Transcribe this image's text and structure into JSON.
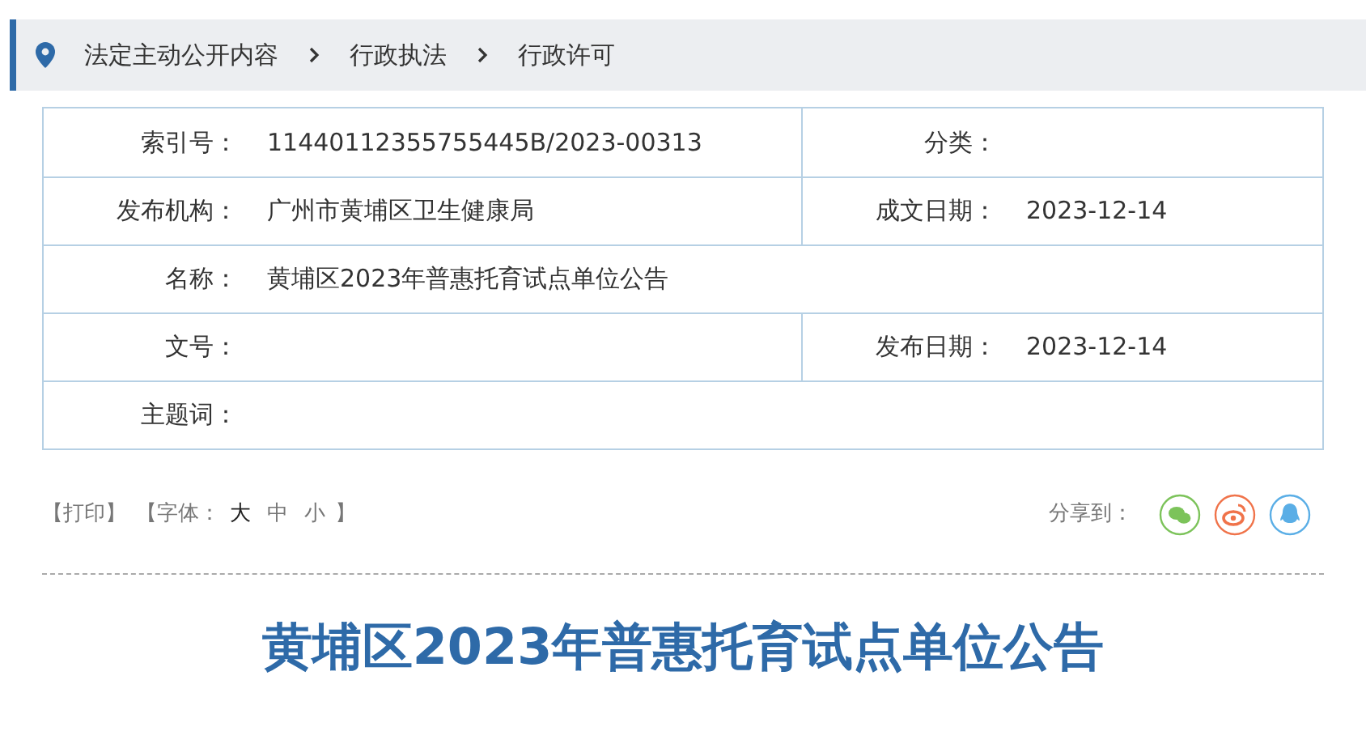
{
  "breadcrumb": [
    "法定主动公开内容",
    "行政执法",
    "行政许可"
  ],
  "info_rows": [
    {
      "cells": [
        {
          "label": "索引号：",
          "value": "11440112355755445B/2023-00313"
        },
        {
          "label": "分类："
        }
      ]
    },
    {
      "cells": [
        {
          "label": "发布机构：",
          "value": "广州市黄埔区卫生健康局"
        },
        {
          "label": "成文日期：",
          "value": "2023-12-14"
        }
      ]
    },
    {
      "cells": [
        {
          "label": "名称：",
          "value": "黄埔区2023年普惠托育试点单位公告"
        }
      ]
    },
    {
      "cells": [
        {
          "label": "文号："
        },
        {
          "label": "发布日期：",
          "value": "2023-12-14"
        }
      ]
    },
    {
      "cells": [
        {
          "label": "主题词："
        }
      ]
    }
  ],
  "tools": {
    "print": "【打印】",
    "font_label": "【字体：",
    "font_sizes": [
      {
        "label": "大",
        "selected": true
      },
      {
        "label": "中",
        "selected": false
      },
      {
        "label": "小",
        "selected": false
      }
    ],
    "font_end": "】"
  },
  "share": {
    "label": "分享到：",
    "targets": [
      {
        "kind": "wechat",
        "color": "#7cc35a"
      },
      {
        "kind": "weibo",
        "color": "#f0734a"
      },
      {
        "kind": "qq",
        "color": "#5aaee6"
      }
    ]
  },
  "title": "黄埔区2023年普惠托育试点单位公告"
}
